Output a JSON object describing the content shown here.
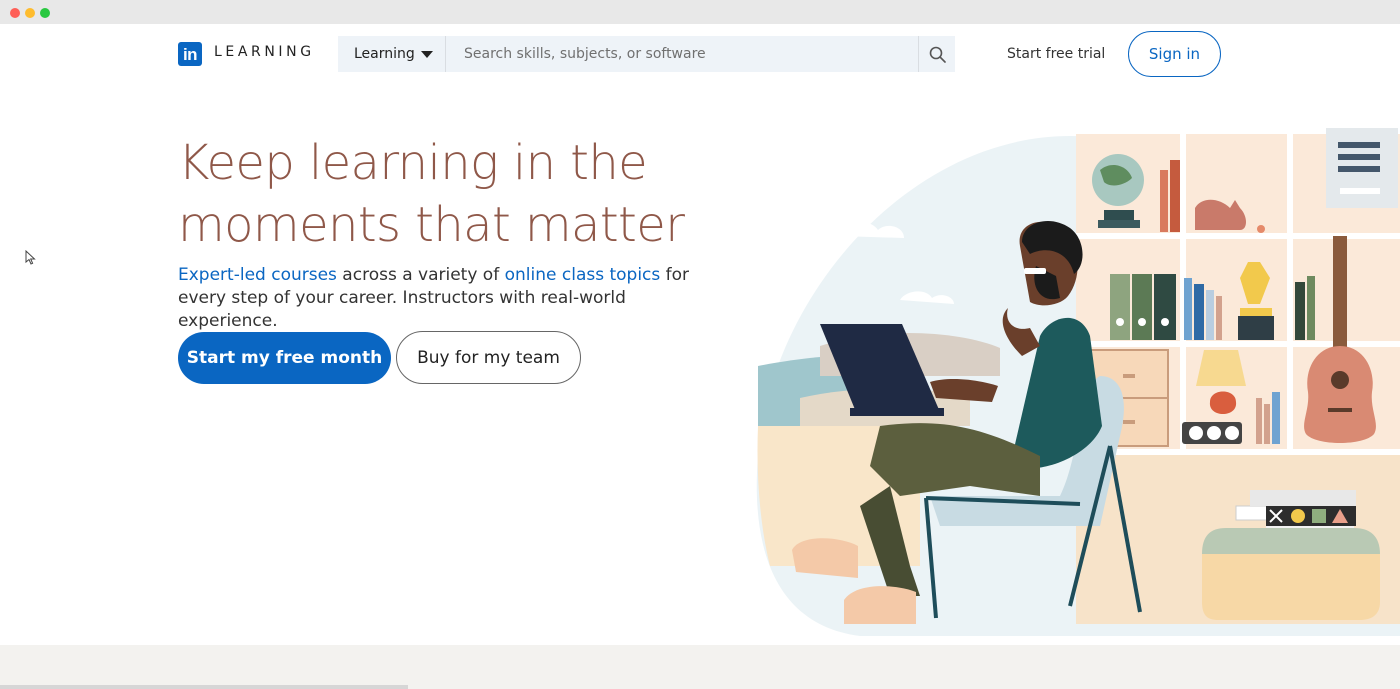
{
  "brand": {
    "logo_text": "in",
    "wordmark": "LEARNING",
    "color": "#0a66c2"
  },
  "search": {
    "category": "Learning",
    "placeholder": "Search skills, subjects, or software",
    "icon": "search-icon"
  },
  "nav": {
    "free_trial": "Start free trial",
    "sign_in": "Sign in"
  },
  "hero": {
    "headline_line1": "Keep learning in the",
    "headline_line2": "moments that matter",
    "sub_link1": "Expert-led courses",
    "sub_text1": " across a variety of ",
    "sub_link2": "online class topics",
    "sub_text2": " for every step of your career. Instructors with real-world experience.",
    "primary_cta": "Start my free month",
    "secondary_cta": "Buy for my team"
  },
  "colors": {
    "accent": "#0a66c2",
    "headline": "#8f5849",
    "search_bg": "#eef3f8"
  }
}
